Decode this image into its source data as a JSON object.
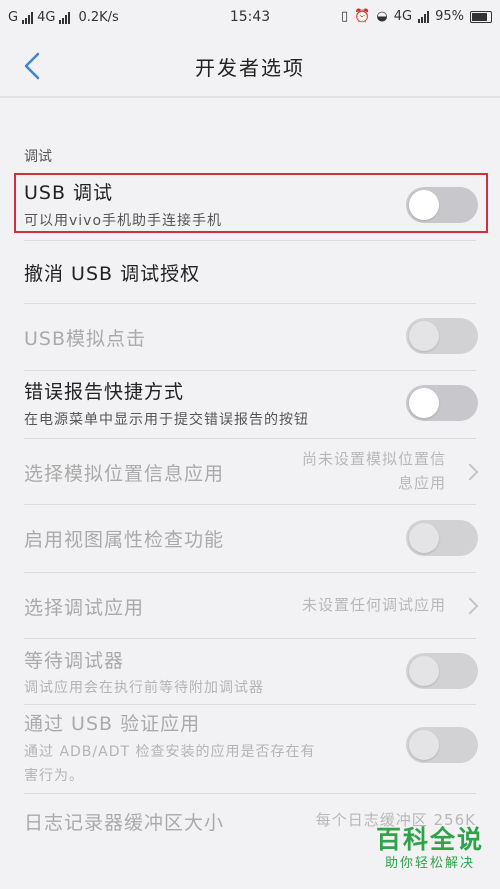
{
  "status_bar": {
    "sim1": "G",
    "sim2_network": "4G",
    "speed": "0.2K/s",
    "time": "15:43",
    "network_right": "4G",
    "battery": "95%"
  },
  "nav": {
    "title": "开发者选项"
  },
  "section": {
    "header": "调试"
  },
  "rows": [
    {
      "title": "USB 调试",
      "subtitle": "可以用vivo手机助手连接手机",
      "toggle_on": false
    },
    {
      "title": "撤消 USB 调试授权"
    },
    {
      "title": "USB模拟点击",
      "toggle_on": false,
      "disabled": true
    },
    {
      "title": "错误报告快捷方式",
      "subtitle": "在电源菜单中显示用于提交错误报告的按钮",
      "toggle_on": false
    },
    {
      "title": "选择模拟位置信息应用",
      "value_line1": "尚未设置模拟位置信",
      "value_line2": "息应用",
      "disabled": true
    },
    {
      "title": "启用视图属性检查功能",
      "toggle_on": false,
      "disabled": true
    },
    {
      "title": "选择调试应用",
      "value": "未设置任何调试应用",
      "disabled": true
    },
    {
      "title": "等待调试器",
      "subtitle": "调试应用会在执行前等待附加调试器",
      "toggle_on": false,
      "disabled": true
    },
    {
      "title": "通过 USB 验证应用",
      "subtitle_line1": "通过 ADB/ADT 检查安装的应用是否存在有",
      "subtitle_line2": "害行为。",
      "toggle_on": false,
      "disabled": true
    },
    {
      "title": "日志记录器缓冲区大小",
      "value": "每个日志缓冲区 256K",
      "disabled": true
    }
  ],
  "watermark": {
    "main": "百科全说",
    "sub": "助你轻松解决"
  }
}
